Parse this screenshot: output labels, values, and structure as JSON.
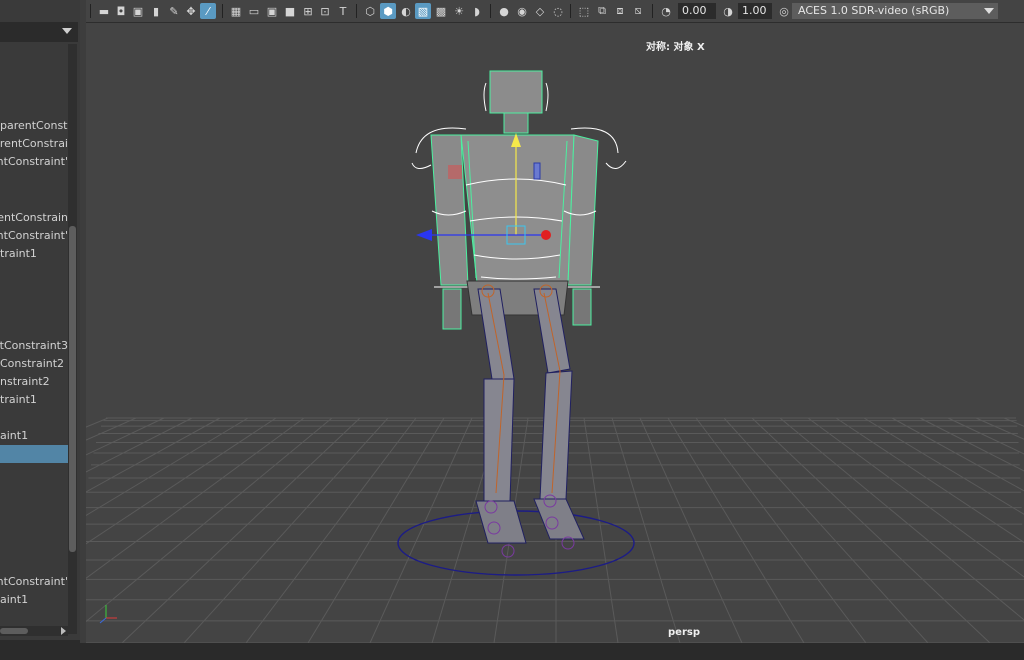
{
  "outliner": {
    "items": [
      {
        "label": "parentConst",
        "selected": false
      },
      {
        "label": "rentConstrai",
        "selected": false
      },
      {
        "label": "ntConstraint'",
        "selected": false
      },
      {
        "label": "entConstrain",
        "selected": false
      },
      {
        "label": "ntConstraint'",
        "selected": false
      },
      {
        "label": "traint1",
        "selected": false
      },
      {
        "label": "ntConstraint3",
        "selected": false
      },
      {
        "label": "Constraint2",
        "selected": false
      },
      {
        "label": "nstraint2",
        "selected": false
      },
      {
        "label": "traint1",
        "selected": false
      },
      {
        "label": "aint1",
        "selected": false
      },
      {
        "label": "",
        "selected": true
      },
      {
        "label": "ntConstraint'",
        "selected": false
      },
      {
        "label": "aint1",
        "selected": false
      }
    ]
  },
  "toolbar": {
    "exposure_value": "0.00",
    "gamma_value": "1.00",
    "color_space": "ACES 1.0 SDR-video (sRGB)"
  },
  "viewport": {
    "hud_title": "对称: 对象 X",
    "camera_label": "persp"
  },
  "colors": {
    "selection_wire": "#4cf0a0",
    "grid": "#5d5d5d",
    "mesh": "#8a8a8a",
    "joint": "#c0642a",
    "control_curve": "#ffffff",
    "ground_circle": "#1a1a8a"
  }
}
